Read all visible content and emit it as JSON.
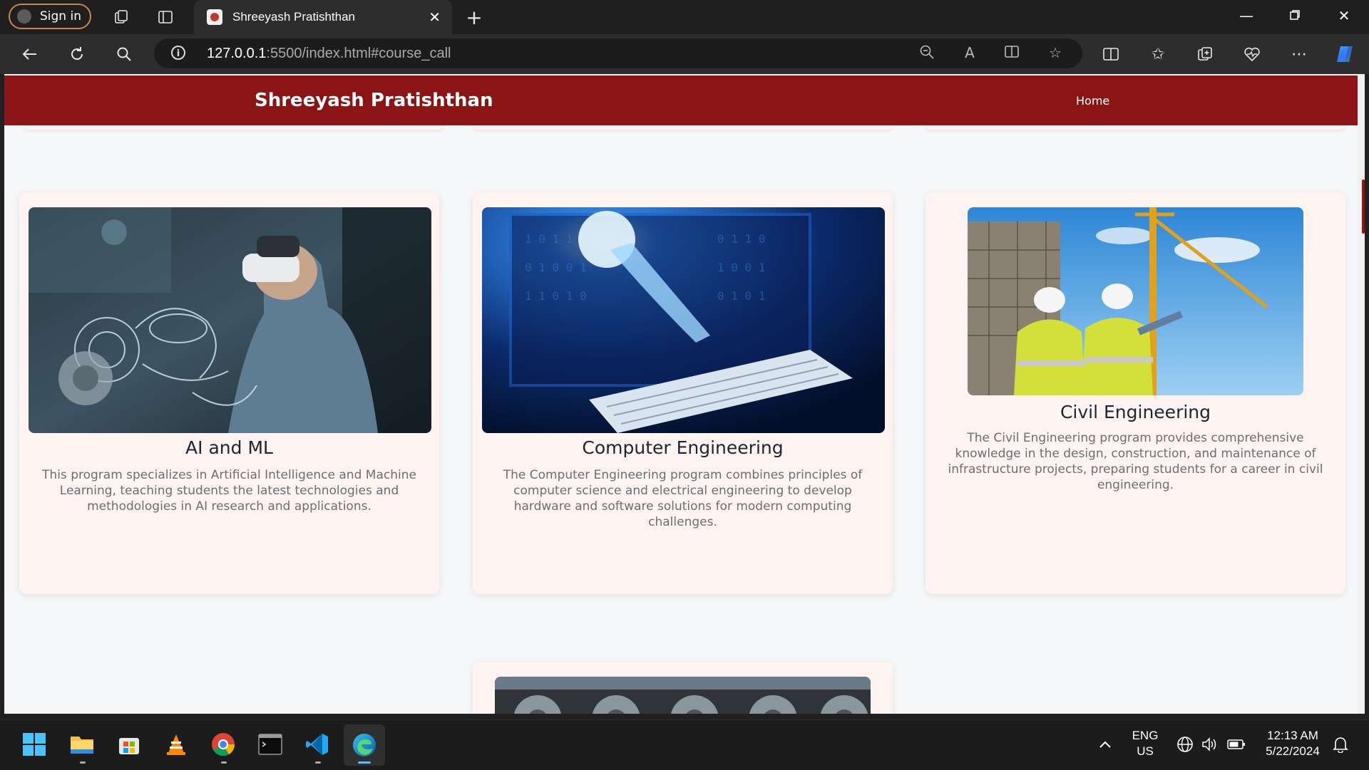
{
  "browser": {
    "signin_label": "Sign in",
    "tab_title": "Shreeyash Pratishthan",
    "url_host": "127.0.0.1",
    "url_rest": ":5500/index.html#course_call"
  },
  "site": {
    "brand": "Shreeyash Pratishthan",
    "nav_home": "Home"
  },
  "courses": [
    {
      "title": "AI and ML",
      "description": "This program specializes in Artificial Intelligence and Machine Learning, teaching students the latest technologies and methodologies in AI research and applications.",
      "image_icon": "vr-headset-engineer-image"
    },
    {
      "title": "Computer Engineering",
      "description": "The Computer Engineering program combines principles of computer science and electrical engineering to develop hardware and software solutions for modern computing challenges.",
      "image_icon": "digital-hand-keyboard-image"
    },
    {
      "title": "Civil Engineering",
      "description": "The Civil Engineering program provides comprehensive knowledge in the design, construction, and maintenance of infrastructure projects, preparing students for a career in civil engineering.",
      "image_icon": "construction-workers-crane-image"
    }
  ],
  "taskbar": {
    "lang_top": "ENG",
    "lang_bottom": "US",
    "time": "12:13 AM",
    "date": "5/22/2024"
  },
  "colors": {
    "header": "#8b1515",
    "card_bg": "#fff3f2",
    "page_bg": "#f6f7f9"
  }
}
